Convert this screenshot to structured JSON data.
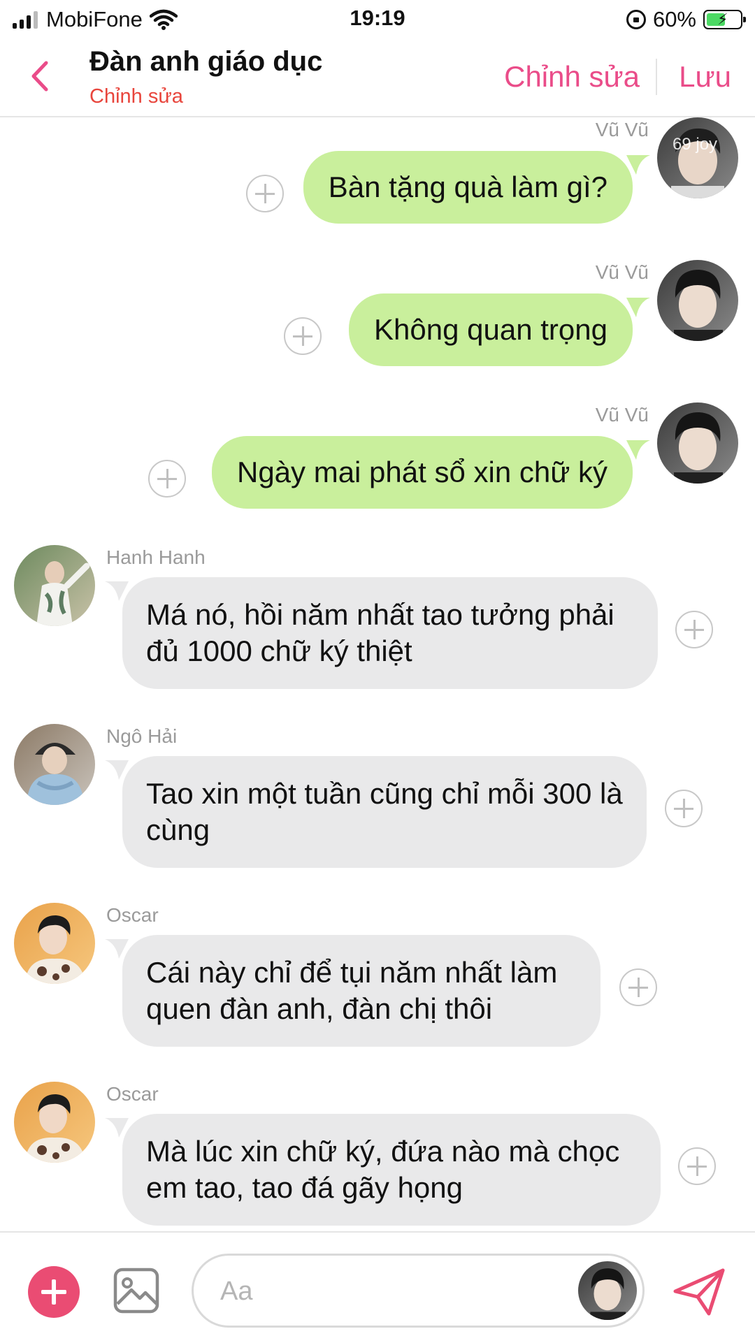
{
  "status_bar": {
    "carrier": "MobiFone",
    "time": "19:19",
    "battery_percent": "60%",
    "battery_level": 0.6,
    "charging": true
  },
  "header": {
    "title": "Đàn anh giáo dục",
    "subtitle": "Chỉnh sửa",
    "edit_label": "Chỉnh sửa",
    "save_label": "Lưu"
  },
  "messages": [
    {
      "sender": "Vũ Vũ",
      "text": "Bàn tặng quà làm gì?",
      "direction": "outgoing",
      "avatar_watermark": "69 joy"
    },
    {
      "sender": "Vũ Vũ",
      "text": "Không quan trọng",
      "direction": "outgoing"
    },
    {
      "sender": "Vũ Vũ",
      "text": "Ngày mai phát sổ xin chữ ký",
      "direction": "outgoing"
    },
    {
      "sender": "Hanh Hanh",
      "text": "Má nó, hồi năm nhất tao tưởng phải đủ 1000 chữ ký thiệt",
      "direction": "incoming"
    },
    {
      "sender": "Ngô Hải",
      "text": "Tao xin một tuần cũng chỉ mỗi 300 là cùng",
      "direction": "incoming"
    },
    {
      "sender": "Oscar",
      "text": "Cái này chỉ để tụi năm nhất làm quen đàn anh, đàn chị thôi",
      "direction": "incoming"
    },
    {
      "sender": "Oscar",
      "text": "Mà lúc xin chữ ký, đứa nào mà chọc em tao, tao đá gãy họng",
      "direction": "incoming"
    }
  ],
  "composer": {
    "placeholder": "Aa"
  },
  "colors": {
    "accent": "#ea4c89",
    "subtitle": "#e8453c",
    "outgoing_bubble": "#c9ef9c",
    "incoming_bubble": "#e9e9ea"
  },
  "icons": {
    "back": "chevron-left-icon",
    "add": "plus-circle-icon",
    "image": "image-icon",
    "send": "paper-plane-icon",
    "reaction": "plus-outline-icon"
  }
}
